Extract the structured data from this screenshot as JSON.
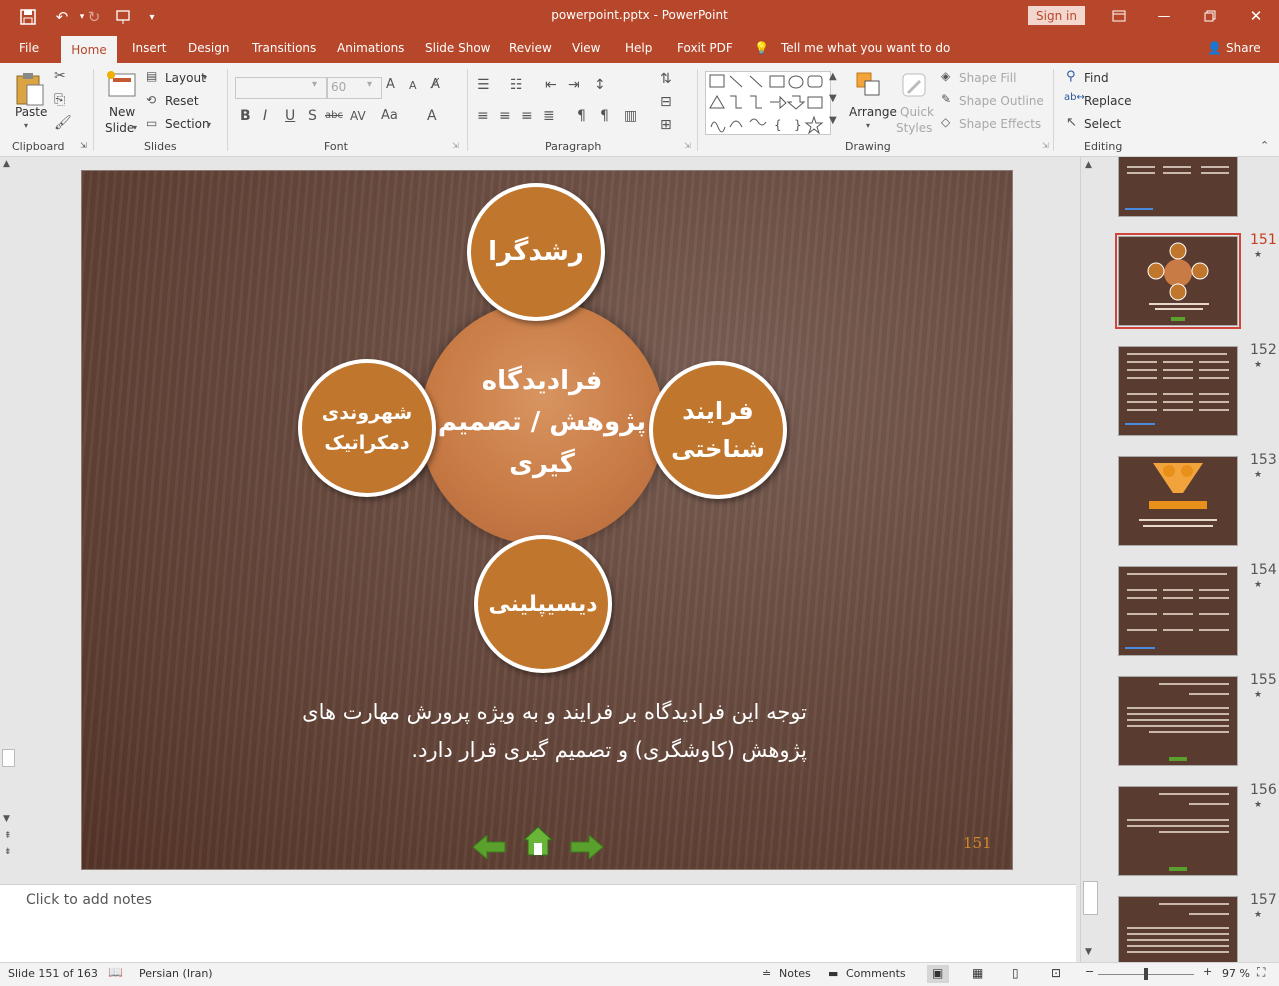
{
  "window": {
    "doc_title": "powerpoint.pptx  -  PowerPoint",
    "sign_in": "Sign in"
  },
  "tabs": [
    "File",
    "Home",
    "Insert",
    "Design",
    "Transitions",
    "Animations",
    "Slide Show",
    "Review",
    "View",
    "Help",
    "Foxit PDF"
  ],
  "tell_me": "Tell me what you want to do",
  "share": "Share",
  "ribbon": {
    "clipboard": {
      "label": "Clipboard",
      "paste": "Paste"
    },
    "slides": {
      "label": "Slides",
      "new_slide_1": "New",
      "new_slide_2": "Slide",
      "layout": "Layout",
      "reset": "Reset",
      "section": "Section"
    },
    "font": {
      "label": "Font",
      "size": "60"
    },
    "paragraph": {
      "label": "Paragraph"
    },
    "drawing": {
      "label": "Drawing",
      "arrange": "Arrange",
      "quick_styles_1": "Quick",
      "quick_styles_2": "Styles",
      "shape_fill": "Shape Fill",
      "shape_outline": "Shape Outline",
      "shape_effects": "Shape Effects"
    },
    "editing": {
      "label": "Editing",
      "find": "Find",
      "replace": "Replace",
      "select": "Select"
    }
  },
  "slide": {
    "top_circle": "رشدگرا",
    "right_circle_1": "فرایند",
    "right_circle_2": "شناختی",
    "left_circle_1": "شهروندی",
    "left_circle_2": "دمکراتیک",
    "bottom_circle": "دیسیپلینی",
    "center_1": "فرادیدگاه",
    "center_2": "پژوهش / تصمیم",
    "center_3": "گیری",
    "body_text": "توجه این فرادیدگاه بر فرایند و به ویژه پرورش مهارت های پژوهش (کاوشگری) و تصمیم گیری قرار دارد.",
    "number": "151"
  },
  "thumbnails": [
    "151",
    "152",
    "153",
    "154",
    "155",
    "156",
    "157"
  ],
  "notes_placeholder": "Click to add notes",
  "status": {
    "slide_info": "Slide 151 of 163",
    "language": "Persian (Iran)",
    "notes": "Notes",
    "comments": "Comments",
    "zoom": "97 %"
  }
}
